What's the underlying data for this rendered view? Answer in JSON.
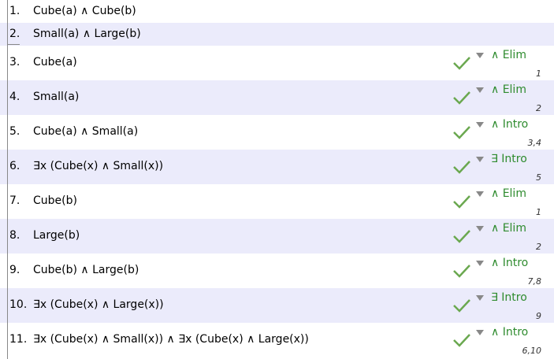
{
  "premises": [
    {
      "num": "1.",
      "sentence": "Cube(a) ∧ Cube(b)"
    },
    {
      "num": "2.",
      "sentence": "Small(a) ∧ Large(b)"
    }
  ],
  "steps": [
    {
      "num": "3.",
      "sentence": "Cube(a)",
      "rule": "∧ Elim",
      "cite": "1"
    },
    {
      "num": "4.",
      "sentence": "Small(a)",
      "rule": "∧ Elim",
      "cite": "2"
    },
    {
      "num": "5.",
      "sentence": "Cube(a) ∧ Small(a)",
      "rule": "∧ Intro",
      "cite": "3,4"
    },
    {
      "num": "6.",
      "sentence": "∃x (Cube(x) ∧ Small(x))",
      "rule": "∃ Intro",
      "cite": "5"
    },
    {
      "num": "7.",
      "sentence": "Cube(b)",
      "rule": "∧ Elim",
      "cite": "1"
    },
    {
      "num": "8.",
      "sentence": "Large(b)",
      "rule": "∧ Elim",
      "cite": "2"
    },
    {
      "num": "9.",
      "sentence": "Cube(b) ∧ Large(b)",
      "rule": "∧ Intro",
      "cite": "7,8"
    },
    {
      "num": "10.",
      "sentence": "∃x (Cube(x) ∧ Large(x))",
      "rule": "∃ Intro",
      "cite": "9"
    },
    {
      "num": "11.",
      "sentence": "∃x (Cube(x) ∧ Small(x)) ∧ ∃x (Cube(x) ∧ Large(x))",
      "rule": "∧ Intro",
      "cite": "6,10"
    }
  ],
  "colors": {
    "rule": "#2e8b2e",
    "check": "#6aa84f",
    "alt_row": "#ebebfb"
  },
  "icons": {
    "status": "check-icon",
    "menu": "triangle-down-icon"
  }
}
